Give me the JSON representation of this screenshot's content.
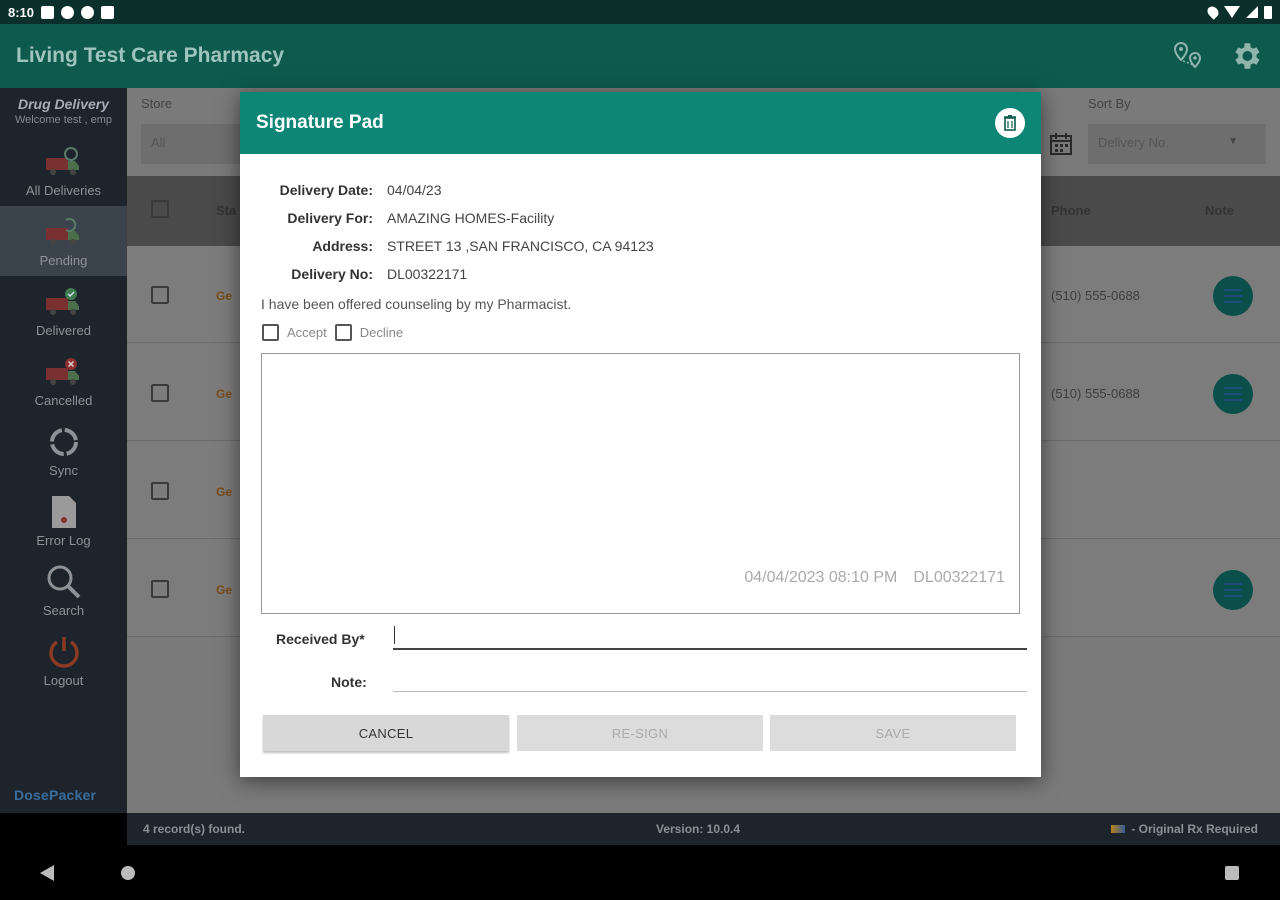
{
  "statusbar": {
    "time": "8:10"
  },
  "app": {
    "title": "Living Test Care Pharmacy"
  },
  "sidebar": {
    "app_name": "Drug Delivery",
    "welcome": "Welcome test , emp",
    "items": [
      {
        "label": "All Deliveries"
      },
      {
        "label": "Pending"
      },
      {
        "label": "Delivered"
      },
      {
        "label": "Cancelled"
      },
      {
        "label": "Sync"
      },
      {
        "label": "Error Log"
      },
      {
        "label": "Search"
      },
      {
        "label": "Logout"
      }
    ],
    "brand": "DosePacker"
  },
  "filters": {
    "store_label": "Store",
    "store_value": "All",
    "sort_label": "Sort By",
    "sort_value": "Delivery No."
  },
  "table": {
    "headers": {
      "status": "Sta",
      "phone": "Phone",
      "note": "Note"
    },
    "rows": [
      {
        "status": "Ge",
        "phone": "(510) 555-0688"
      },
      {
        "status": "Ge",
        "phone": "(510) 555-0688"
      },
      {
        "status": "Ge",
        "phone": ""
      },
      {
        "status": "Ge",
        "phone": ""
      }
    ]
  },
  "footer": {
    "records": "4 record(s) found.",
    "version": "Version: 10.0.4",
    "legend": "- Original Rx Required"
  },
  "dialog": {
    "title": "Signature Pad",
    "fields": [
      {
        "key": "Delivery Date:",
        "value": "04/04/23"
      },
      {
        "key": "Delivery For:",
        "value": "AMAZING HOMES-Facility"
      },
      {
        "key": "Address:",
        "value": "STREET 13 ,SAN FRANCISCO, CA 94123"
      },
      {
        "key": "Delivery No:",
        "value": "DL00322171"
      }
    ],
    "counsel_text": "I have been offered counseling by my Pharmacist.",
    "accept_label": "Accept",
    "decline_label": "Decline",
    "sig_datetime": "04/04/2023 08:10 PM",
    "sig_delivery_no": "DL00322171",
    "received_label": "Received By*",
    "received_value": "",
    "note_label": "Note:",
    "note_value": "",
    "cancel_label": "CANCEL",
    "resign_label": "RE-SIGN",
    "save_label": "SAVE"
  }
}
